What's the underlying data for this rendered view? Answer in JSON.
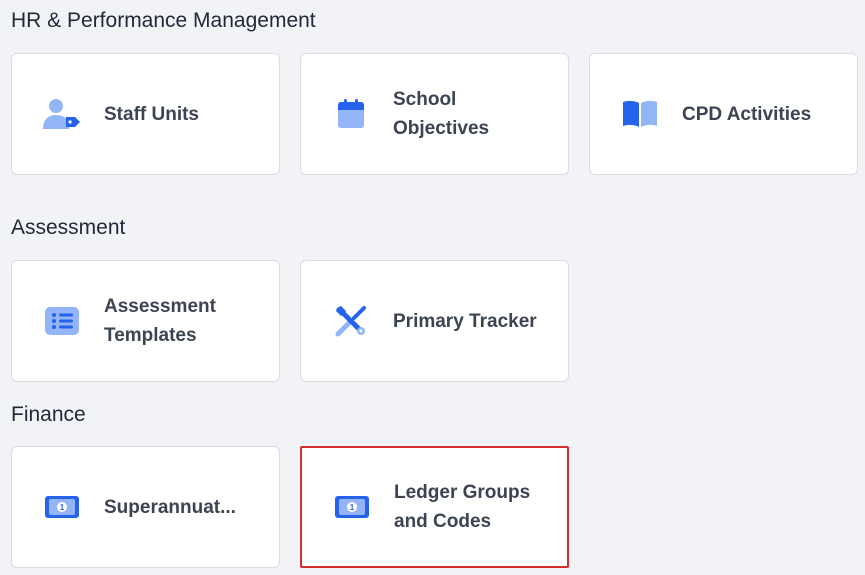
{
  "sections": [
    {
      "title": "HR & Performance Management",
      "cards": [
        {
          "label": "Staff Units",
          "icon": "user-tag-icon"
        },
        {
          "label": "School Objectives",
          "icon": "calendar-icon"
        },
        {
          "label": "CPD Activities",
          "icon": "book-open-icon"
        }
      ]
    },
    {
      "title": "Assessment",
      "cards": [
        {
          "label": "Assessment Templates",
          "icon": "list-icon"
        },
        {
          "label": "Primary Tracker",
          "icon": "tools-icon"
        }
      ]
    },
    {
      "title": "Finance",
      "cards": [
        {
          "label": "Superannuat...",
          "icon": "money-bill-icon"
        },
        {
          "label": "Ledger Groups and Codes",
          "icon": "money-bill-icon"
        }
      ]
    }
  ],
  "colors": {
    "icon_primary": "#2563eb",
    "icon_light": "#93b4f6",
    "highlight_border": "#d32f2f"
  }
}
